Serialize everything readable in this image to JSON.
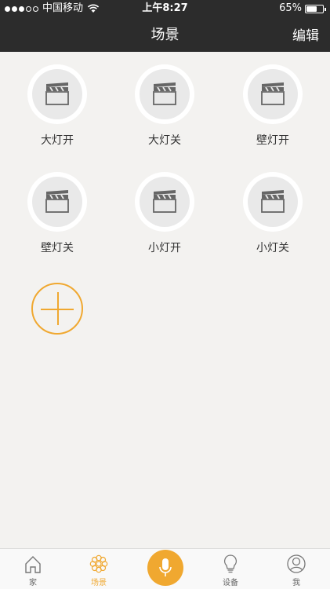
{
  "status_bar": {
    "carrier": "中国移动",
    "time": "上午8:27",
    "battery_percent": "65%",
    "battery_level": 0.65,
    "signal_bars_filled": 3,
    "signal_bars_total": 5
  },
  "nav": {
    "title": "场景",
    "edit_label": "编辑"
  },
  "scenes": [
    {
      "label": "大灯开",
      "icon": "clapperboard-icon"
    },
    {
      "label": "大灯关",
      "icon": "clapperboard-icon"
    },
    {
      "label": "壁灯开",
      "icon": "clapperboard-icon"
    },
    {
      "label": "壁灯关",
      "icon": "clapperboard-icon"
    },
    {
      "label": "小灯开",
      "icon": "clapperboard-icon"
    },
    {
      "label": "小灯关",
      "icon": "clapperboard-icon"
    }
  ],
  "add_button": {
    "icon": "plus-icon"
  },
  "tabs": [
    {
      "label": "家",
      "icon": "home-icon",
      "active": false
    },
    {
      "label": "场景",
      "icon": "flower-icon",
      "active": true
    },
    {
      "label": "",
      "icon": "microphone-icon",
      "active": false
    },
    {
      "label": "设备",
      "icon": "lightbulb-icon",
      "active": false
    },
    {
      "label": "我",
      "icon": "user-icon",
      "active": false
    }
  ],
  "colors": {
    "accent": "#f0a830",
    "navbar": "#2c2c2c",
    "background": "#f3f2f0"
  }
}
